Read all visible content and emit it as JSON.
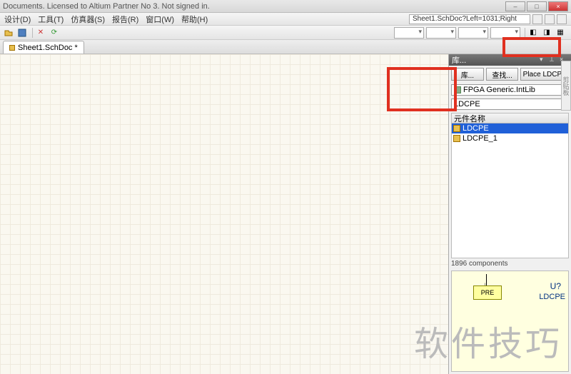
{
  "titlebar": {
    "text": "Documents. Licensed to Altium Partner No 3. Not signed in."
  },
  "menu": {
    "design": "设计(D)",
    "tool": "工具(T)",
    "simulator": "仿真器(S)",
    "report": "报告(R)",
    "window": "窗口(W)",
    "help": "帮助(H)"
  },
  "context_field": "Sheet1.SchDoc?Left=1031;Right",
  "tab": {
    "label": "Sheet1.SchDoc *"
  },
  "lib": {
    "title": "库...",
    "btn_lib": "库...",
    "btn_search": "查找...",
    "btn_place": "Place LDCPE",
    "library_name": "FPGA Generic.IntLib",
    "filter": "LDCPE",
    "col_name": "元件名称",
    "items": [
      {
        "name": "LDCPE"
      },
      {
        "name": "LDCPE_1"
      }
    ],
    "count": "1896 components",
    "preview": {
      "ref": "U?",
      "name": "LDCPE",
      "box": "PRE"
    }
  },
  "sidetab": "剪贴板",
  "watermark": "软件技巧"
}
